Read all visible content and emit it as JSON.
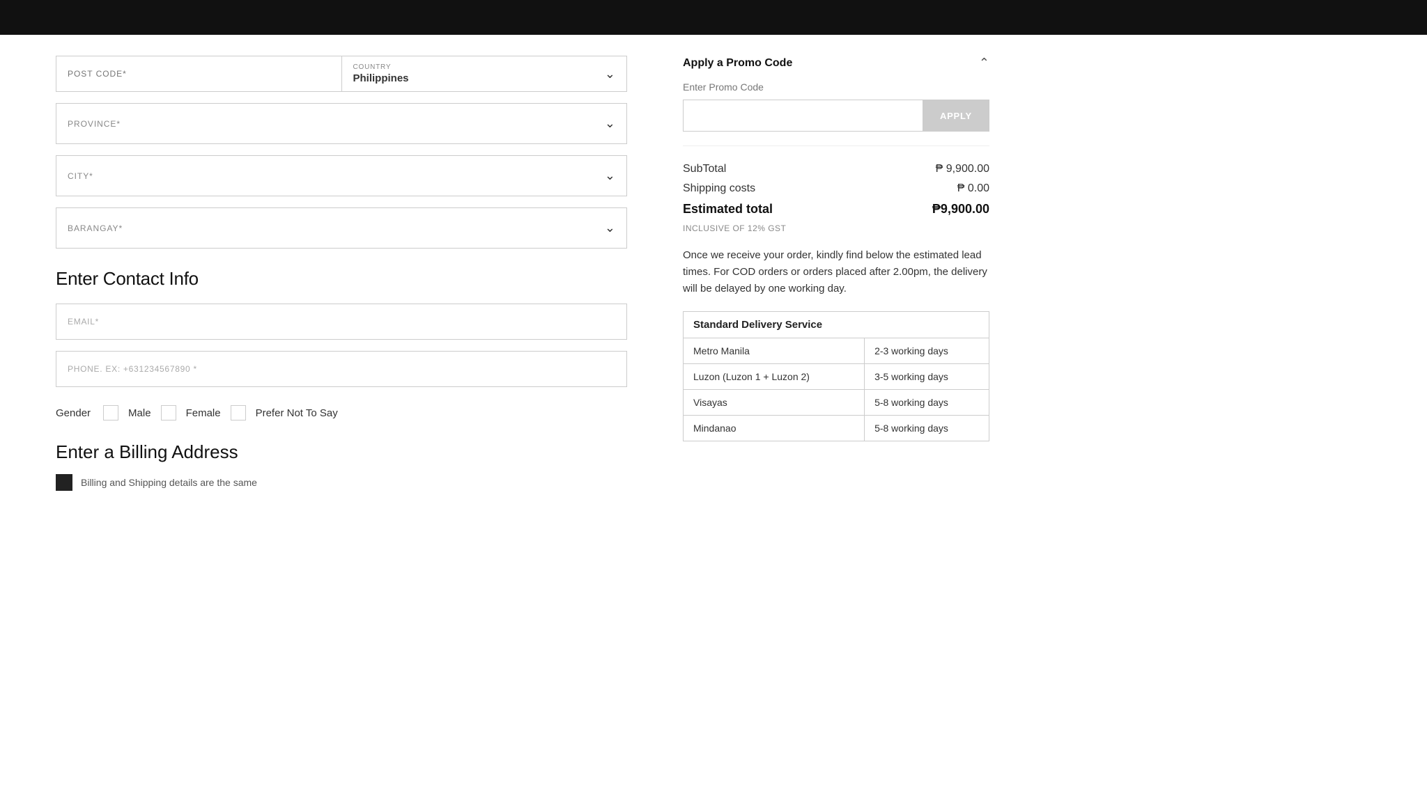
{
  "topbar": {},
  "form": {
    "postcode_placeholder": "POST CODE*",
    "country_label": "COUNTRY",
    "country_value": "Philippines",
    "province_label": "PROVINCE*",
    "city_label": "CITY*",
    "barangay_label": "BARANGAY*",
    "contact_section_title": "Enter Contact Info",
    "email_placeholder": "EMAIL*",
    "phone_placeholder": "PHONE. EX: +631234567890 *",
    "gender_label": "Gender",
    "gender_options": [
      "Male",
      "Female",
      "Prefer Not To Say"
    ],
    "billing_section_title": "Enter a Billing Address",
    "billing_option_text": "Billing and Shipping details are the same"
  },
  "sidebar": {
    "promo_title": "Apply a Promo Code",
    "promo_label": "Enter Promo Code",
    "promo_input_value": "",
    "apply_button_label": "APPLY",
    "subtotal_label": "SubTotal",
    "subtotal_value": "₱ 9,900.00",
    "shipping_label": "Shipping costs",
    "shipping_value": "₱ 0.00",
    "total_label": "Estimated total",
    "total_value": "₱9,900.00",
    "gst_note": "INCLUSIVE OF 12% GST",
    "delivery_note": "Once we receive your order, kindly find below the estimated lead times. For COD orders or orders placed after 2.00pm, the delivery will be delayed by one working day.",
    "delivery_table_header": "Standard Delivery Service",
    "delivery_rows": [
      {
        "region": "Metro Manila",
        "days": "2-3 working days"
      },
      {
        "region": "Luzon (Luzon 1 + Luzon 2)",
        "days": "3-5 working days"
      },
      {
        "region": "Visayas",
        "days": "5-8 working days"
      },
      {
        "region": "Mindanao",
        "days": "5-8 working days"
      }
    ]
  }
}
